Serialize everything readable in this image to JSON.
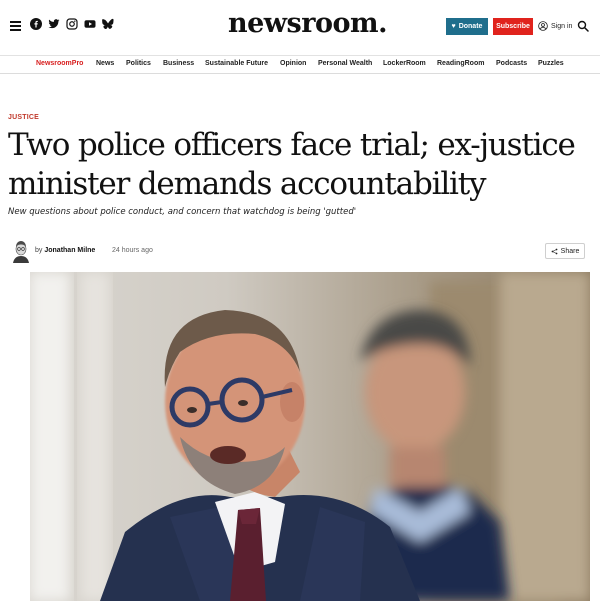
{
  "header": {
    "logo": "newsroom.",
    "donate_label": "Donate",
    "subscribe_label": "Subscribe",
    "signin_label": "Sign in",
    "socials": [
      "facebook-icon",
      "twitter-icon",
      "instagram-icon",
      "youtube-icon",
      "bluesky-icon"
    ],
    "colors": {
      "donate": "#1f6e8c",
      "subscribe": "#e0231d",
      "accent": "#d82020"
    }
  },
  "nav": {
    "items": [
      {
        "label": "NewsroomPro"
      },
      {
        "label": "News"
      },
      {
        "label": "Politics"
      },
      {
        "label": "Business"
      },
      {
        "label": "Sustainable Future"
      },
      {
        "label": "Opinion"
      },
      {
        "label": "Personal Wealth"
      },
      {
        "label": "LockerRoom"
      },
      {
        "label": "ReadingRoom"
      },
      {
        "label": "Podcasts"
      },
      {
        "label": "Puzzles"
      }
    ]
  },
  "article": {
    "kicker": "JUSTICE",
    "headline_line1": "Two police officers face trial; ex-justice",
    "headline_line2": "minister demands accountability",
    "standfirst": "New questions about police conduct, and concern that watchdog is being 'gutted'",
    "byline_prefix": "by",
    "author": "Jonathan Milne",
    "time": "24 hours ago",
    "share_label": "Share"
  }
}
